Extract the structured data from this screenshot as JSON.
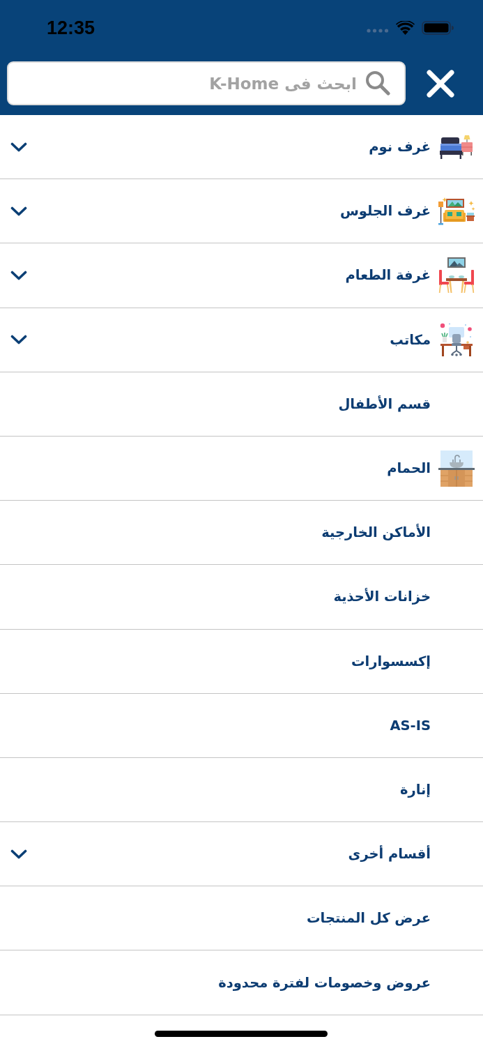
{
  "status_bar": {
    "time": "12:35"
  },
  "search": {
    "placeholder": "ابحث فى K-Home"
  },
  "menu": {
    "items": [
      {
        "label": "غرف نوم",
        "kind": "bedroom",
        "expandable": true
      },
      {
        "label": "غرف الجلوس",
        "kind": "living-room",
        "expandable": true
      },
      {
        "label": "غرفة الطعام",
        "kind": "dining-room",
        "expandable": true
      },
      {
        "label": "مكاتب",
        "kind": "office",
        "expandable": true
      },
      {
        "label": "قسم الأطفال",
        "kind": "plain",
        "expandable": false
      },
      {
        "label": "الحمام",
        "kind": "bathroom",
        "expandable": false
      },
      {
        "label": "الأماكن الخارجية",
        "kind": "plain",
        "expandable": false
      },
      {
        "label": "خزانات الأحذية",
        "kind": "plain",
        "expandable": false
      },
      {
        "label": "إكسسوارات",
        "kind": "plain",
        "expandable": false
      },
      {
        "label": "AS-IS",
        "kind": "plain",
        "expandable": false
      },
      {
        "label": "إنارة",
        "kind": "plain",
        "expandable": false
      },
      {
        "label": "أقسام أخرى",
        "kind": "plain",
        "expandable": true
      },
      {
        "label": "عرض كل المنتجات",
        "kind": "plain",
        "expandable": false
      },
      {
        "label": "عروض وخصومات لفترة محدودة",
        "kind": "plain",
        "expandable": false
      }
    ]
  }
}
